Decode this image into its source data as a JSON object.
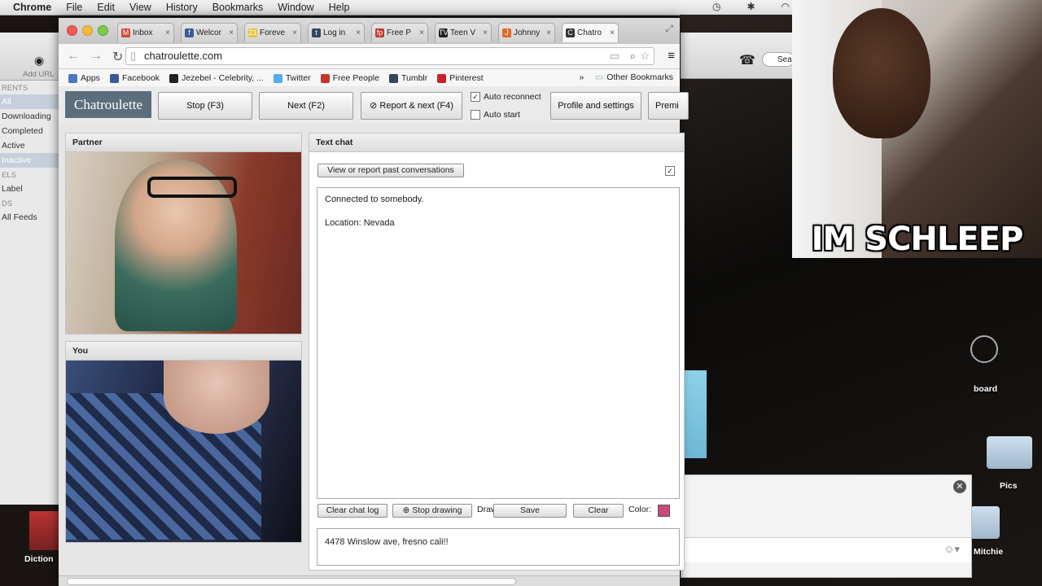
{
  "os_menubar": {
    "app": "Chrome",
    "menus": [
      "File",
      "Edit",
      "View",
      "History",
      "Bookmarks",
      "Window",
      "Help"
    ]
  },
  "browser": {
    "tabs": [
      {
        "label": "Inbox",
        "icon": "gmail-icon",
        "color": "#d44638",
        "glyph": "M"
      },
      {
        "label": "Welcor",
        "icon": "facebook-icon",
        "color": "#3b5998",
        "glyph": "f"
      },
      {
        "label": "Foreve",
        "icon": "forever21-icon",
        "color": "#e7c33a",
        "glyph": "21"
      },
      {
        "label": "Log in",
        "icon": "tumblr-icon",
        "color": "#34465d",
        "glyph": "t"
      },
      {
        "label": "Free P",
        "icon": "freepeople-icon",
        "color": "#c0392b",
        "glyph": "fp"
      },
      {
        "label": "Teen V",
        "icon": "teenvogue-icon",
        "color": "#222222",
        "glyph": "TV"
      },
      {
        "label": "Johnny",
        "icon": "johnny-icon",
        "color": "#e06a2a",
        "glyph": "J"
      },
      {
        "label": "Chatro",
        "icon": "chatroulette-icon",
        "color": "#333333",
        "glyph": "C",
        "active": true
      }
    ],
    "url": "chatroulette.com",
    "bookmarks": [
      {
        "label": "Apps",
        "icon": "apps-grid-icon",
        "color": "#4a76c0"
      },
      {
        "label": "Facebook",
        "icon": "facebook-icon",
        "color": "#3b5998"
      },
      {
        "label": "Jezebel - Celebrity, ...",
        "icon": "jezebel-icon",
        "color": "#222222"
      },
      {
        "label": "Twitter",
        "icon": "twitter-icon",
        "color": "#55acee"
      },
      {
        "label": "Free People",
        "icon": "freepeople-icon",
        "color": "#c0392b"
      },
      {
        "label": "Tumblr",
        "icon": "tumblr-icon",
        "color": "#34465d"
      },
      {
        "label": "Pinterest",
        "icon": "pinterest-icon",
        "color": "#cb2027"
      }
    ],
    "other_bookmarks": "Other Bookmarks"
  },
  "chatroulette": {
    "logo": "Chatroulette",
    "stop_button": "Stop (F3)",
    "next_button": "Next (F2)",
    "report_button": "⊘ Report & next (F4)",
    "auto_reconnect": "Auto reconnect",
    "auto_reconnect_checked": true,
    "auto_start": "Auto start",
    "auto_start_checked": false,
    "profile_button": "Profile and settings",
    "premium_button": "Premi",
    "partner_label": "Partner",
    "you_label": "You",
    "text_chat_label": "Text chat",
    "view_report_button": "View or report past conversations",
    "messages": [
      "Connected to somebody.",
      "Location: Nevada"
    ],
    "clear_chat_button": "Clear chat log",
    "stop_drawing_button": "⊕ Stop drawing",
    "drawing_label": "Drawing:",
    "save_button": "Save",
    "clear_button": "Clear",
    "color_label": "Color:",
    "chat_input_value": "4478 Winslow ave, fresno cali!!"
  },
  "finder_sidebar": {
    "header": "RENTS",
    "items": [
      "All",
      "Downloading",
      "Completed",
      "Active",
      "Inactive"
    ],
    "labels_header": "ELS",
    "label_item": "Label",
    "feeds_header": "DS",
    "feeds_item": "All Feeds",
    "add_url": "Add URL"
  },
  "desktop": {
    "meme_caption": "IM SCHLEEP",
    "icons": [
      "board",
      "Pics",
      "Mitchie",
      "Diction"
    ],
    "search_placeholder": "Sea"
  }
}
